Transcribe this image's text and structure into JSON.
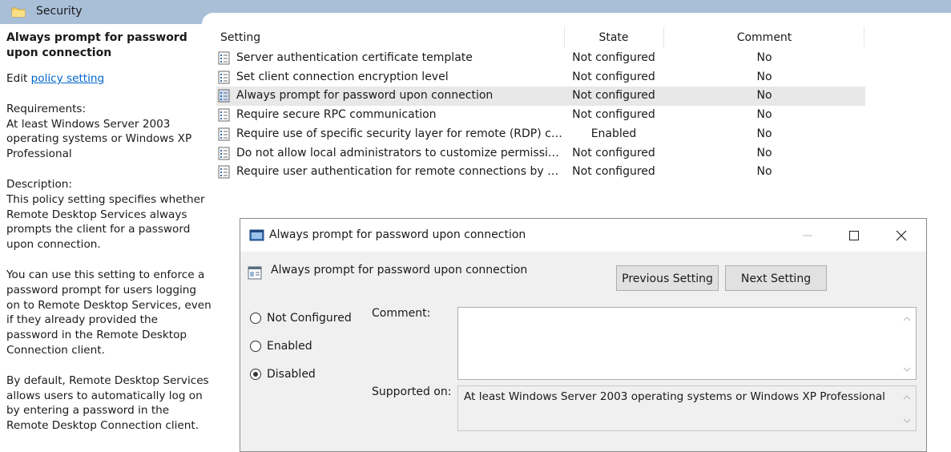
{
  "header": {
    "title": "Security"
  },
  "left_pane": {
    "title": "Always prompt for password upon connection",
    "edit_prefix": "Edit ",
    "edit_link": "policy setting ",
    "requirements": "Requirements:\nAt least Windows Server 2003 operating systems or Windows XP Professional",
    "description": "Description:\nThis policy setting specifies whether Remote Desktop Services always prompts the client for a password upon connection.",
    "para2": "You can use this setting to enforce a password prompt for users logging on to Remote Desktop Services, even if they already provided the password in the Remote Desktop Connection client.",
    "para3": "By default, Remote Desktop Services allows users to automatically log on by entering a password in the Remote Desktop Connection client."
  },
  "table": {
    "columns": {
      "setting": "Setting",
      "state": "State",
      "comment": "Comment"
    },
    "rows": [
      {
        "name": "Server authentication certificate template",
        "state": "Not configured",
        "comment": "No"
      },
      {
        "name": "Set client connection encryption level",
        "state": "Not configured",
        "comment": "No"
      },
      {
        "name": "Always prompt for password upon connection",
        "state": "Not configured",
        "comment": "No"
      },
      {
        "name": "Require secure RPC communication",
        "state": "Not configured",
        "comment": "No"
      },
      {
        "name": "Require use of specific security layer for remote (RDP) connec...",
        "state": "Enabled",
        "comment": "No"
      },
      {
        "name": "Do not allow local administrators to customize permissions",
        "state": "Not configured",
        "comment": "No"
      },
      {
        "name": "Require user authentication for remote connections by using...",
        "state": "Not configured",
        "comment": "No"
      }
    ],
    "selected_row": 2
  },
  "dialog": {
    "window_title": "Always prompt for password upon connection",
    "setting_title": "Always prompt for password upon connection",
    "previous_button": "Previous Setting",
    "next_button": "Next Setting",
    "options": {
      "not_configured": "Not Configured",
      "enabled": "Enabled",
      "disabled": "Disabled"
    },
    "selected_option": "Disabled",
    "comment_label": "Comment:",
    "comment_value": "",
    "supported_label": "Supported on:",
    "supported_value": "At least Windows Server 2003 operating systems or Windows XP Professional"
  }
}
